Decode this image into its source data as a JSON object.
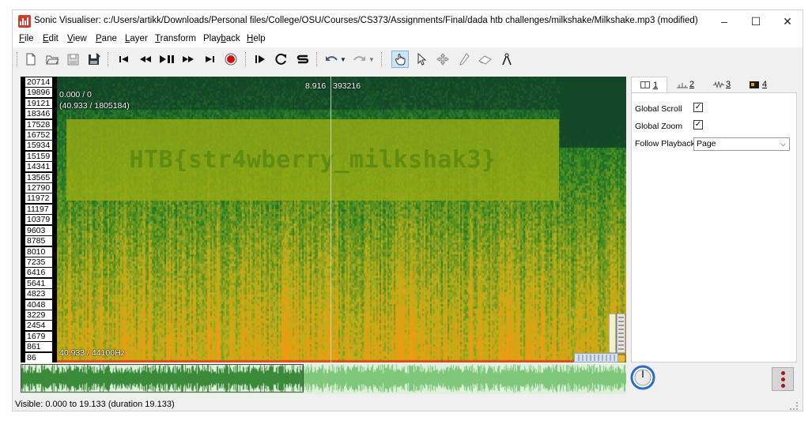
{
  "window": {
    "title": "Sonic Visualiser: c:/Users/artikk/Downloads/Personal files/College/OSU/Courses/CS373/Assignments/Final/dada htb challenges/milkshake/Milkshake.mp3 (modified)",
    "controls": {
      "minimize": "–",
      "maximize": "☐",
      "close": "✕"
    }
  },
  "menu": [
    {
      "label": "File",
      "accel": "F",
      "rest": "ile"
    },
    {
      "label": "Edit",
      "accel": "E",
      "rest": "dit"
    },
    {
      "label": "View",
      "accel": "V",
      "rest": "iew"
    },
    {
      "label": "Pane",
      "accel": "P",
      "rest": "ane"
    },
    {
      "label": "Layer",
      "accel": "L",
      "rest": "ayer"
    },
    {
      "label": "Transform",
      "accel": "T",
      "rest": "ransform"
    },
    {
      "label": "Playback",
      "pre": "Play",
      "accel": "b",
      "rest": "ack"
    },
    {
      "label": "Help",
      "accel": "H",
      "rest": "elp"
    }
  ],
  "toolbar": {
    "icons": [
      "new-file-icon",
      "open-folder-icon",
      "save-icon",
      "save-as-icon",
      "rewind-start-icon",
      "rewind-icon",
      "play-pause-icon",
      "fast-forward-icon",
      "fast-forward-end-icon",
      "record-icon",
      "play-selection-icon",
      "loop-icon",
      "solo-icon",
      "undo-icon",
      "redo-icon",
      "navigate-hand-icon",
      "select-arrow-icon",
      "move-icon",
      "draw-pencil-icon",
      "erase-icon",
      "measure-icon"
    ],
    "active_tool": "navigate-hand-icon"
  },
  "spectrogram": {
    "freq_scale": [
      "20714",
      "19896",
      "19121",
      "18346",
      "17528",
      "16752",
      "15934",
      "15159",
      "14341",
      "13565",
      "12790",
      "11972",
      "11197",
      "10379",
      "9603",
      "8785",
      "8010",
      "7235",
      "6416",
      "5641",
      "4823",
      "4048",
      "3229",
      "2454",
      "1679",
      "861",
      "86"
    ],
    "top_left_readout": "0.000 / 0",
    "top_left_readout2": "(40.933 / 1805184)",
    "playhead_time": "8.916",
    "playhead_frame": "393216",
    "bottom_left_readout": "40.933 / 44100Hz",
    "hidden_message": "HTB{str4wberry_milkshak3}",
    "colors": {
      "band": "#96aa14",
      "text": "#5f8c12"
    }
  },
  "side_panel": {
    "tabs": [
      {
        "num": "1",
        "icon": "pane-layout-icon"
      },
      {
        "num": "2",
        "icon": "time-ruler-icon"
      },
      {
        "num": "3",
        "icon": "waveform-icon"
      },
      {
        "num": "4",
        "icon": "spectrogram-layer-icon"
      }
    ],
    "selected_tab": "1",
    "global_scroll_label": "Global Scroll",
    "global_scroll_checked": "✓",
    "global_zoom_label": "Global Zoom",
    "global_zoom_checked": "✓",
    "follow_playback_label": "Follow Playback",
    "follow_playback_value": "Page"
  },
  "status": {
    "text": "Visible: 0.000 to 19.133 (duration 19.133)"
  }
}
